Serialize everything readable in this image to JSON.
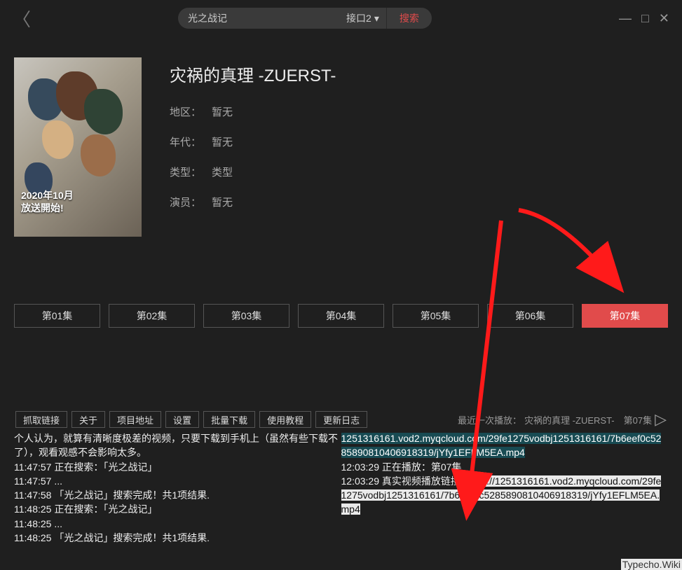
{
  "search": {
    "value": "光之战记",
    "interface": "接口2",
    "button": "搜索"
  },
  "window": {
    "min": "—",
    "max": "□",
    "close": "✕"
  },
  "media": {
    "title": "灾祸的真理 -ZUERST-",
    "region_k": "地区：",
    "region_v": "暂无",
    "year_k": "年代：",
    "year_v": "暂无",
    "type_k": "类型：",
    "type_v": "类型",
    "cast_k": "演员：",
    "cast_v": "暂无",
    "poster_badge_l1": "2020年10月",
    "poster_badge_l2": "放送開始!"
  },
  "episodes": [
    "第01集",
    "第02集",
    "第03集",
    "第04集",
    "第05集",
    "第06集",
    "第07集"
  ],
  "active_episode_index": 6,
  "toolbar": [
    "抓取链接",
    "关于",
    "项目地址",
    "设置",
    "批量下载",
    "使用教程",
    "更新日志"
  ],
  "last_play": {
    "label": "最近一次播放：",
    "value": "灾祸的真理 -ZUERST-　第07集"
  },
  "log_left": [
    "个人认为，就算有清晰度极差的视频，只要下载到手机上（虽然有些下载不了），观看观感不会影响太多。",
    "11:47:57 正在搜索：「光之战记」",
    "11:47:57 ...",
    "11:47:58 「光之战记」搜索完成！共1项结果.",
    "11:48:25 正在搜索：「光之战记」",
    "11:48:25 ...",
    "11:48:25 「光之战记」搜索完成！共1项结果."
  ],
  "log_right": {
    "cyan1": "1251316161.vod2.myqcloud.com/29fe1275vodbj1251316161/7b6eef0c5285890810406918319/jYfy1EFLM5EA.mp4",
    "line2": "12:03:29 正在播放：第07集",
    "line3_a": "12:03:29 真实视频播放链接：",
    "line3_b": "http://1251316161.vod2.myqcloud.com/29fe1275vodbj1251316161/7b6eef0c5285890810406918319/jYfy1EFLM5EA.mp4"
  },
  "watermark": "Typecho.Wiki"
}
